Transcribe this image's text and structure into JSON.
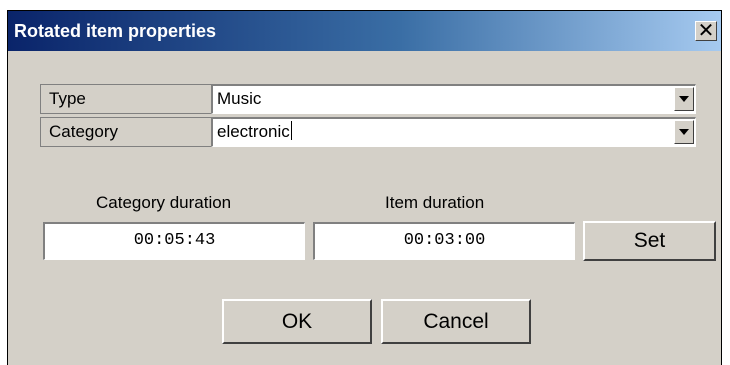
{
  "window": {
    "title": "Rotated item properties",
    "close_glyph": "✕"
  },
  "type_row": {
    "label": "Type",
    "value": "Music"
  },
  "category_row": {
    "label": "Category",
    "value": "electronic"
  },
  "durations": {
    "category_label": "Category duration",
    "category_value": "00:05:43",
    "item_label": "Item duration",
    "item_value": "00:03:00"
  },
  "buttons": {
    "set": "Set",
    "ok": "OK",
    "cancel": "Cancel"
  },
  "colors": {
    "face": "#d4d0c8",
    "titlebar_start": "#0a246a",
    "titlebar_end": "#a6caf0"
  },
  "icons": {
    "close": "close-icon",
    "dropdown": "chevron-down-icon"
  }
}
